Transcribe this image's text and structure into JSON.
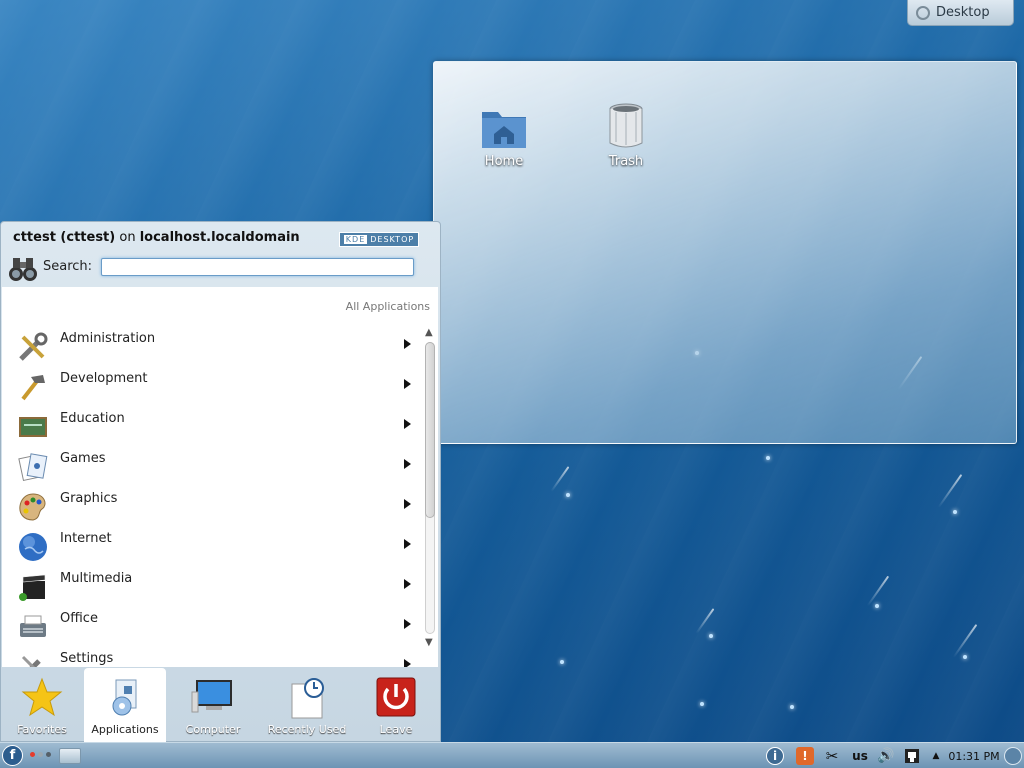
{
  "desktop_tab": {
    "label": "Desktop"
  },
  "folder_view": {
    "icons": [
      {
        "label": "Home"
      },
      {
        "label": "Trash"
      }
    ]
  },
  "kickoff": {
    "user": "cttest (cttest)",
    "on_word": "on",
    "host": "localhost.localdomain",
    "badge_left": "KDE",
    "badge_right": "DESKTOP",
    "search_label": "Search:",
    "search_value": "",
    "breadcrumb": "All Applications",
    "categories": [
      {
        "label": "Administration",
        "icon": "tools-icon"
      },
      {
        "label": "Development",
        "icon": "hammer-icon"
      },
      {
        "label": "Education",
        "icon": "chalkboard-icon"
      },
      {
        "label": "Games",
        "icon": "cards-icon"
      },
      {
        "label": "Graphics",
        "icon": "palette-icon"
      },
      {
        "label": "Internet",
        "icon": "globe-icon"
      },
      {
        "label": "Multimedia",
        "icon": "clapperboard-icon"
      },
      {
        "label": "Office",
        "icon": "typewriter-icon"
      },
      {
        "label": "Settings",
        "icon": "settings-tools-icon"
      }
    ],
    "tabs": [
      {
        "label": "Favorites",
        "icon": "star-icon"
      },
      {
        "label": "Applications",
        "icon": "applications-icon"
      },
      {
        "label": "Computer",
        "icon": "monitor-icon"
      },
      {
        "label": "Recently Used",
        "icon": "clock-document-icon"
      },
      {
        "label": "Leave",
        "icon": "power-icon"
      }
    ]
  },
  "taskbar": {
    "launcher_glyph": "f",
    "tray": {
      "info_glyph": "i",
      "alert_glyph": "!",
      "keyboard_layout": "us",
      "clock": "01:31 PM"
    }
  },
  "colors": {
    "accent": "#2c5d8e",
    "leave_red": "#c8231b",
    "pager_colors": [
      "#e53b2c",
      "#9aa7b1",
      "#555f68"
    ]
  }
}
